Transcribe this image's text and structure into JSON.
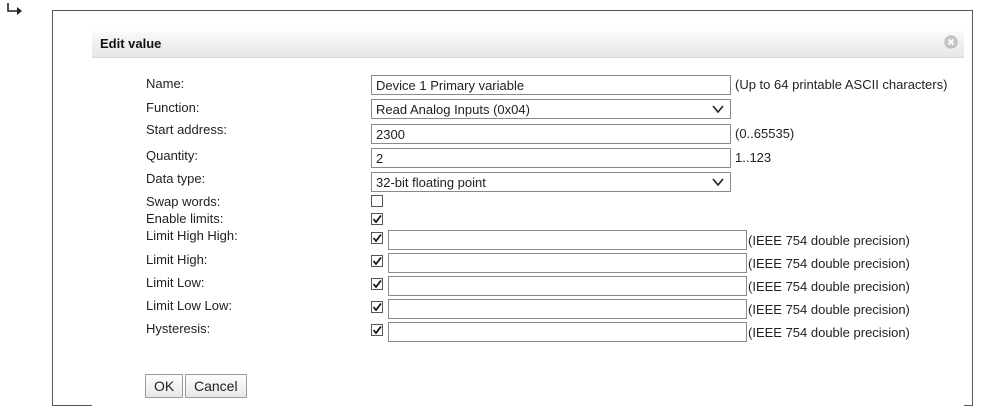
{
  "dialog": {
    "title": "Edit value",
    "name_label": "Name:",
    "name_value": "Device 1 Primary variable",
    "name_hint": "(Up to 64 printable ASCII characters)",
    "function_label": "Function:",
    "function_value": "Read Analog Inputs (0x04)",
    "start_address_label": "Start address:",
    "start_address_value": "2300",
    "start_address_hint": "(0..65535)",
    "quantity_label": "Quantity:",
    "quantity_value": "2",
    "quantity_hint": "1..123",
    "data_type_label": "Data type:",
    "data_type_value": "32-bit floating point",
    "swap_words_label": "Swap words:",
    "swap_words_checked": false,
    "enable_limits_label": "Enable limits:",
    "enable_limits_checked": true,
    "limits": [
      {
        "label": "Limit High High:",
        "checked": true,
        "value": "",
        "hint": "(IEEE 754 double precision)"
      },
      {
        "label": "Limit High:",
        "checked": true,
        "value": "",
        "hint": "(IEEE 754 double precision)"
      },
      {
        "label": "Limit Low:",
        "checked": true,
        "value": "",
        "hint": "(IEEE 754 double precision)"
      },
      {
        "label": "Limit Low Low:",
        "checked": true,
        "value": "",
        "hint": "(IEEE 754 double precision)"
      },
      {
        "label": "Hysteresis:",
        "checked": true,
        "value": "",
        "hint": "(IEEE 754 double precision)"
      }
    ],
    "ok_label": "OK",
    "cancel_label": "Cancel"
  },
  "icons": [
    "return-arrow-icon",
    "close-icon",
    "chevron-down-icon",
    "checkmark-icon"
  ]
}
